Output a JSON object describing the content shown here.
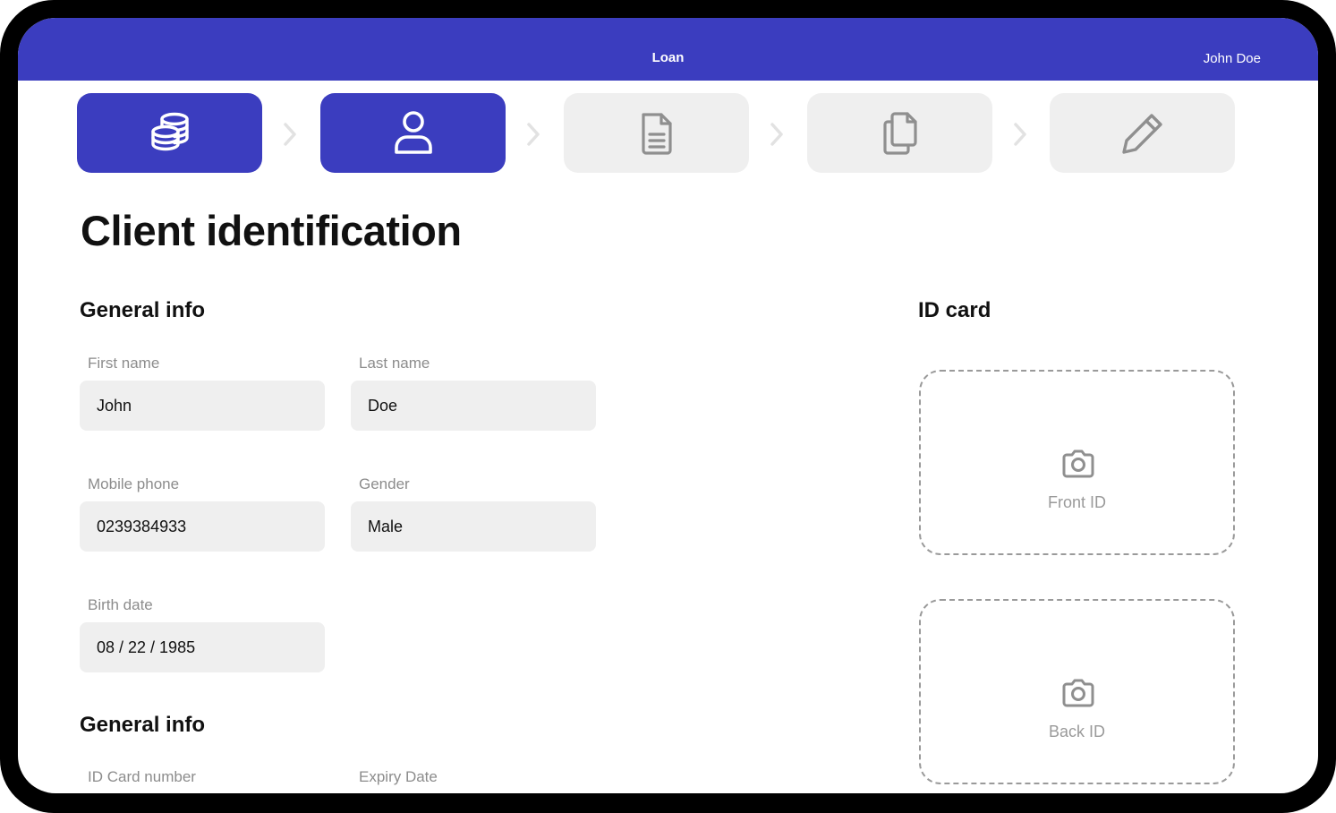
{
  "header": {
    "title": "Loan",
    "user": "John Doe"
  },
  "colors": {
    "accent": "#3b3dbf",
    "field_bg": "#efefef",
    "inactive_step": "#efefef",
    "muted_text": "#8c8c8c"
  },
  "steps": [
    {
      "icon": "coins-icon",
      "state": "active"
    },
    {
      "icon": "user-icon",
      "state": "active"
    },
    {
      "icon": "document-icon",
      "state": "inactive"
    },
    {
      "icon": "copy-icon",
      "state": "inactive"
    },
    {
      "icon": "pencil-icon",
      "state": "inactive"
    }
  ],
  "page": {
    "title": "Client identification"
  },
  "general_info": {
    "title": "General info",
    "first_name": {
      "label": "First name",
      "value": "John"
    },
    "last_name": {
      "label": "Last name",
      "value": "Doe"
    },
    "mobile_phone": {
      "label": "Mobile phone",
      "value": "0239384933"
    },
    "gender": {
      "label": "Gender",
      "value": "Male"
    },
    "birth_date": {
      "label": "Birth date",
      "value": "08 / 22 / 1985"
    }
  },
  "id_info": {
    "title": "General info",
    "id_card_number": {
      "label": "ID Card number"
    },
    "expiry_date": {
      "label": "Expiry Date"
    }
  },
  "id_card": {
    "title": "ID card",
    "front": {
      "label": "Front ID",
      "icon": "camera-icon"
    },
    "back": {
      "label": "Back ID",
      "icon": "camera-icon"
    }
  }
}
